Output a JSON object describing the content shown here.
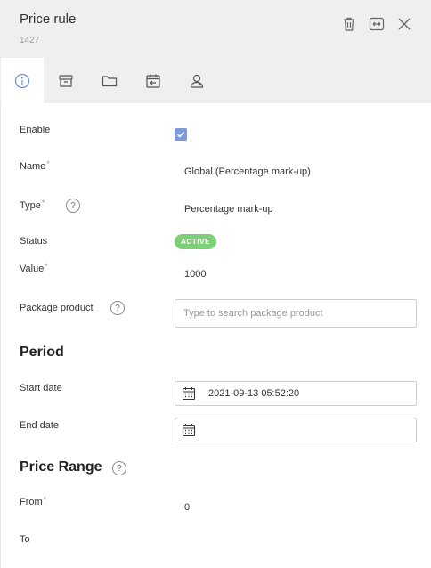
{
  "header": {
    "title": "Price rule",
    "id": "1427",
    "actions": [
      "trash-icon",
      "expand-horizontal-icon",
      "close-icon"
    ]
  },
  "tabs": [
    {
      "name": "info-icon",
      "active": true
    },
    {
      "name": "box-icon",
      "active": false
    },
    {
      "name": "folder-icon",
      "active": false
    },
    {
      "name": "calendar-arrow-icon",
      "active": false
    },
    {
      "name": "user-icon",
      "active": false
    }
  ],
  "form": {
    "enable_label": "Enable",
    "enable_checked": true,
    "name_label": "Name",
    "name_value": "Global (Percentage mark-up)",
    "type_label": "Type",
    "type_value": "Percentage mark-up",
    "status_label": "Status",
    "status_value": "ACTIVE",
    "value_label": "Value",
    "value_value": "1000",
    "package_label": "Package product",
    "package_placeholder": "Type to search package product",
    "required_mark": "*",
    "help_mark": "?"
  },
  "period": {
    "heading": "Period",
    "start_label": "Start date",
    "start_value": "2021-09-13 05:52:20",
    "end_label": "End date",
    "end_value": ""
  },
  "price_range": {
    "heading": "Price Range",
    "from_label": "From",
    "from_value": "0",
    "to_label": "To"
  },
  "colors": {
    "header_bg": "#efefef",
    "checkbox": "#7b9ad6",
    "active_badge": "#7dcf77",
    "active_tab_icon": "#6b8fd6"
  }
}
